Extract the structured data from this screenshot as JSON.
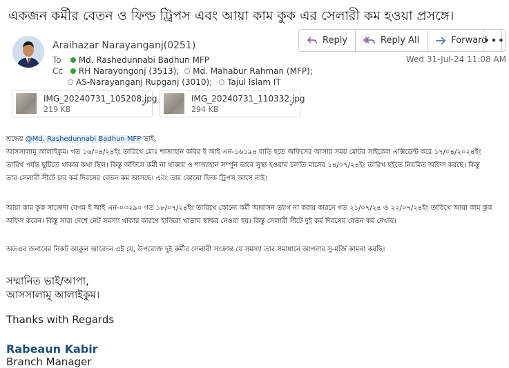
{
  "email": {
    "subject": "একজন কর্মীর বেতন ও ফিল্ড ট্রিপস এবং আয়া কাম কুক এর সেলারী কম হওয়া প্রসঙ্গে।",
    "sender": "Araihazar Narayanganj(0251)",
    "to_label": "To",
    "to": [
      "Md. Rashedunnabi Badhun MFP"
    ],
    "cc_label": "Cc",
    "cc_line1": [
      "RH Narayongonj (3513);",
      "Md. Mahabur Rahman (MFP);"
    ],
    "cc_line2": [
      "AS-Narayanganj Rupganj (3010);",
      "Tajul Islam IT"
    ],
    "datetime": "Wed 31-Jul-24 11:08 AM"
  },
  "actions": {
    "reply": "Reply",
    "reply_all": "Reply All",
    "forward": "Forward",
    "more": "•••"
  },
  "attachments": [
    {
      "name": "IMG_20240731_105208.jpg",
      "size": "219 KB"
    },
    {
      "name": "IMG_20240731_110332.jpg",
      "size": "294 KB"
    }
  ],
  "body": {
    "greeting_prefix": "শ্রদ্ধেয় ",
    "mention": "@Md. Rashedunnabi Badhun MFP",
    "greeting_suffix": " ভাই,",
    "p1": [
      "আসসালামু আলাইকুম। গত ১৬/০৪/২৪ইং তারিখে মোঃ শাজাহান কবির ই আই এন-১৬১৯৪ বাড়ি হতে অফিসের আসার সময় মোটর সাইকেল এক্সিডেন্ট করে ১৭/০৪/২০২৪ইং",
      "তারিখ পর্যন্ত ছুটিতে থাকার কথা ছিল। কিন্তু অফিসে কর্মী না থাকায় ও শাজাহান সর্ম্পুন ভাবে সুস্থ্য হওয়ায় চলতি মাসের ১৪/০৭/২৪ইং তারিখ হইতে নিয়মিত অফিস করছে। কিন্তু",
      "তার সেলারী সীটে চার কর্ম দিবসের বেতন কম আসছে। এবং তার কোনো ফিল্ড ট্রিপস আসে নাই।"
    ],
    "p2": [
      "আয়া কাম কুক সাজেদা বেগম ই আই এন-০৩২৯০ গত ১৮/০৭/২৪ইং তারিখে কোনো কর্মী আবাসন ত্যাগ না করার কারনে গত ২১/০৭/২৪ ও ২২/০৭/২৪ইং তারিখে আয়া কাম কুক",
      "অফিস করেন। কিন্তু সারা দেশে নেট সমস্যা থাকার কারণে হাজিরা খাতায় স্বাক্ষর নেওয়া হয়। কিন্তু সেলারী সীটে দুই কর্ম দিবসের বেতন কম দেখায়।"
    ],
    "p3": "অতএব জনাবের নিকট আকুল আবেদন এই যে, উপরোক্ত দুই কর্মীর সেলারী সংক্রান্ত যে সমস্যা তার সমাধানে আপনার সু-মর্জি কামনা করছি।",
    "closing1": "সম্মানিত ভাই/আপা,",
    "closing2": "আসসালামু আলাইকুম।",
    "thanks": "Thanks with Regards",
    "sig_name": "Rabeaun Kabir",
    "sig_title": "Branch Manager"
  },
  "colors": {
    "accent": "#1f4e79",
    "presence": "#3a9b3a"
  }
}
